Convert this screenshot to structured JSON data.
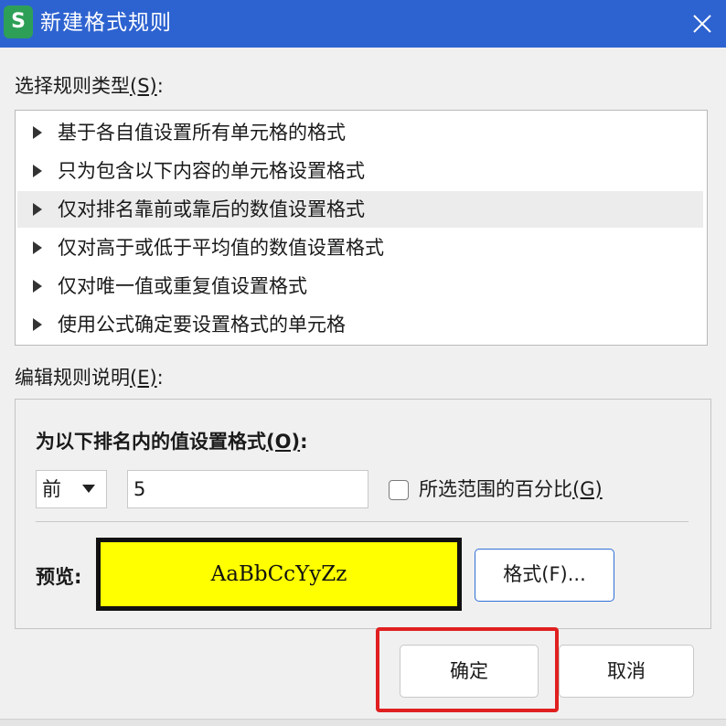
{
  "titlebar": {
    "title": "新建格式规则",
    "app_icon_letter": "S",
    "close_icon": "close-icon",
    "color": "#2d63d0"
  },
  "rule_type": {
    "label": "选择规则类型",
    "label_accel": "(S)",
    "label_colon": ":",
    "items": [
      "基于各自值设置所有单元格的格式",
      "只为包含以下内容的单元格设置格式",
      "仅对排名靠前或靠后的数值设置格式",
      "仅对高于或低于平均值的数值设置格式",
      "仅对唯一值或重复值设置格式",
      "使用公式确定要设置格式的单元格"
    ],
    "selected_index": 2
  },
  "edit": {
    "label": "编辑规则说明",
    "label_accel": "(E)",
    "label_colon": ":",
    "heading": "为以下排名内的值设置格式",
    "heading_accel": "(O)",
    "heading_colon": ":",
    "select_value": "前",
    "rank_value": "5",
    "percent_label": "所选范围的百分比",
    "percent_accel": "(G)",
    "percent_checked": false,
    "preview_label": "预览:",
    "preview_text": "AaBbCcYyZz",
    "preview_color": "#ffff00",
    "format_button": "格式(F)..."
  },
  "buttons": {
    "ok": "确定",
    "cancel": "取消"
  },
  "highlight_color": "#e02020"
}
